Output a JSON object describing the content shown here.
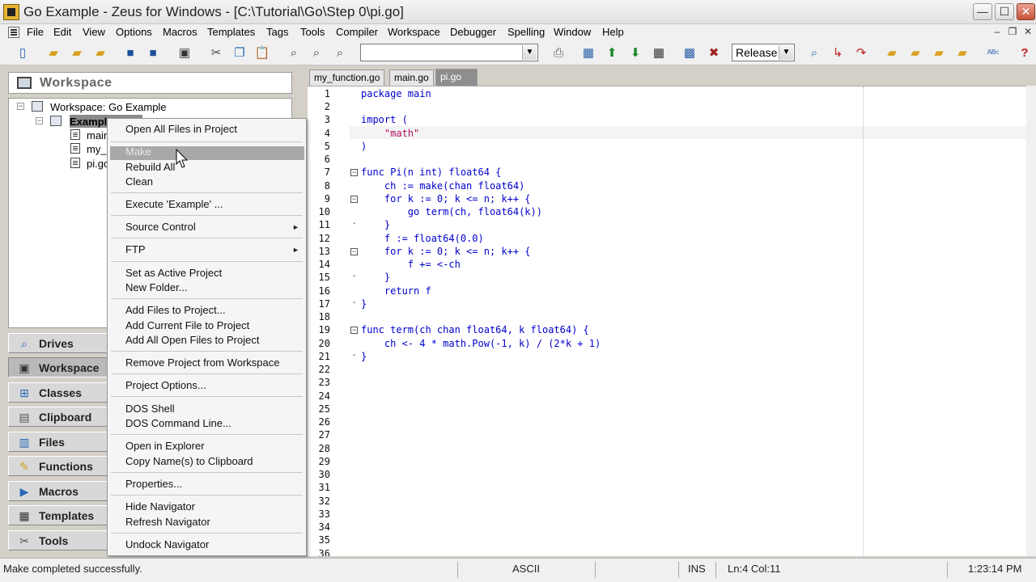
{
  "window": {
    "title": "Go Example - Zeus for Windows - [C:\\Tutorial\\Go\\Step 0\\pi.go]",
    "min": "—",
    "max": "☐",
    "close": "✕"
  },
  "menu": [
    "File",
    "Edit",
    "View",
    "Options",
    "Macros",
    "Templates",
    "Tags",
    "Tools",
    "Compiler",
    "Workspace",
    "Debugger",
    "Spelling",
    "Window",
    "Help"
  ],
  "mdi": {
    "min": "–",
    "restore": "❐",
    "close": "✕"
  },
  "toolbar": {
    "combo_value": "",
    "build_config": "Release"
  },
  "workspace": {
    "header": "Workspace",
    "root": "Workspace: Go Example",
    "project": "Example",
    "files": [
      "main",
      "my_",
      "pi.go"
    ]
  },
  "navigator": [
    "Drives",
    "Workspace",
    "Classes",
    "Clipboard",
    "Files",
    "Functions",
    "Macros",
    "Templates",
    "Tools"
  ],
  "tabs": [
    "my_function.go",
    "main.go",
    "pi.go"
  ],
  "editor": {
    "line_numbers": [
      "1",
      "2",
      "3",
      "4",
      "5",
      "6",
      "7",
      "8",
      "9",
      "10",
      "11",
      "12",
      "13",
      "14",
      "15",
      "16",
      "17",
      "18",
      "19",
      "20",
      "21",
      "22",
      "23",
      "24",
      "25",
      "26",
      "27",
      "28",
      "29",
      "30",
      "31",
      "32",
      "33",
      "34",
      "35",
      "36"
    ],
    "lines": [
      "package main",
      "",
      "import (",
      "    \"math\"",
      ")",
      "",
      "func Pi(n int) float64 {",
      "    ch := make(chan float64)",
      "    for k := 0; k <= n; k++ {",
      "        go term(ch, float64(k))",
      "    }",
      "    f := float64(0.0)",
      "    for k := 0; k <= n; k++ {",
      "        f += <-ch",
      "    }",
      "    return f",
      "}",
      "",
      "func term(ch chan float64, k float64) {",
      "    ch <- 4 * math.Pow(-1, k) / (2*k + 1)",
      "}"
    ]
  },
  "context_menu": {
    "items": [
      "Open All Files in Project",
      "Make",
      "Rebuild All",
      "Clean",
      "Execute 'Example' ...",
      "Source Control",
      "FTP",
      "Set as Active Project",
      "New Folder...",
      "Add Files to Project...",
      "Add Current File to Project",
      "Add All Open Files to Project",
      "Remove Project from Workspace",
      "Project Options...",
      "DOS Shell",
      "DOS Command Line...",
      "Open in Explorer",
      "Copy Name(s) to Clipboard",
      "Properties...",
      "Hide Navigator",
      "Refresh Navigator",
      "Undock Navigator"
    ],
    "submenu_arrow": "►"
  },
  "status": {
    "message": "Make completed successfully.",
    "encoding": "ASCII",
    "mode": "INS",
    "position": "Ln:4 Col:11",
    "time": "1:23:14 PM"
  }
}
